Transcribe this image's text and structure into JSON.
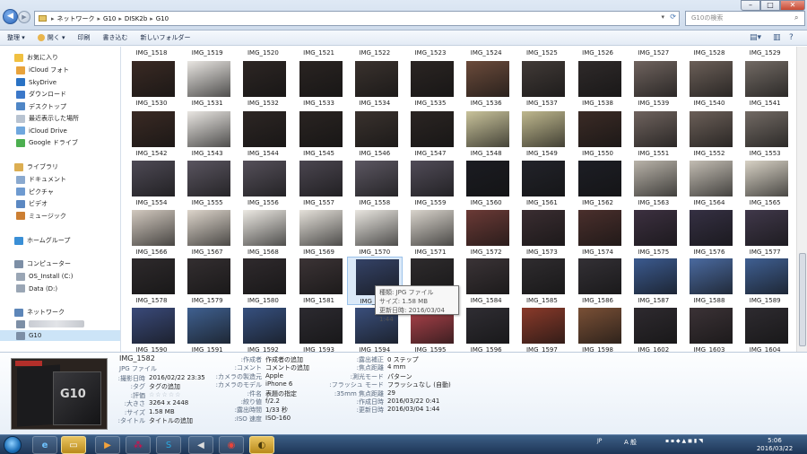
{
  "address": {
    "crumbs": [
      "ネットワーク",
      "G10",
      "DISK2b",
      "G10"
    ],
    "search_placeholder": "G10の検索"
  },
  "toolbar": {
    "organize": "整理 ▾",
    "open": "開く ▾",
    "print": "印刷",
    "burn": "書き込む",
    "new_folder": "新しいフォルダー"
  },
  "navpane": {
    "favorites_header": "お気に入り",
    "favorites": [
      "iCloud フォト",
      "SkyDrive",
      "ダウンロード",
      "デスクトップ",
      "最近表示した場所",
      "iCloud Drive",
      "Google ドライブ"
    ],
    "libraries_header": "ライブラリ",
    "libraries": [
      "ドキュメント",
      "ピクチャ",
      "ビデオ",
      "ミュージック"
    ],
    "homegroup": "ホームグループ",
    "computer_header": "コンピューター",
    "computer": [
      "OS_Install (C:)",
      "Data (D:)"
    ],
    "network_header": "ネットワーク",
    "network_selected": "G10"
  },
  "files": {
    "top_labels": [
      "IMG_1518",
      "IMG_1519",
      "IMG_1520",
      "IMG_1521",
      "IMG_1522",
      "IMG_1523",
      "IMG_1524",
      "IMG_1525",
      "IMG_1526",
      "IMG_1527",
      "IMG_1528",
      "IMG_1529"
    ],
    "rows": [
      [
        "IMG_1530",
        "IMG_1531",
        "IMG_1532",
        "IMG_1533",
        "IMG_1534",
        "IMG_1535",
        "IMG_1536",
        "IMG_1537",
        "IMG_1538",
        "IMG_1539",
        "IMG_1540",
        "IMG_1541"
      ],
      [
        "IMG_1542",
        "IMG_1543",
        "IMG_1544",
        "IMG_1545",
        "IMG_1546",
        "IMG_1547",
        "IMG_1548",
        "IMG_1549",
        "IMG_1550",
        "IMG_1551",
        "IMG_1552",
        "IMG_1553"
      ],
      [
        "IMG_1554",
        "IMG_1555",
        "IMG_1556",
        "IMG_1557",
        "IMG_1558",
        "IMG_1559",
        "IMG_1560",
        "IMG_1561",
        "IMG_1562",
        "IMG_1563",
        "IMG_1564",
        "IMG_1565"
      ],
      [
        "IMG_1566",
        "IMG_1567",
        "IMG_1568",
        "IMG_1569",
        "IMG_1570",
        "IMG_1571",
        "IMG_1572",
        "IMG_1573",
        "IMG_1574",
        "IMG_1575",
        "IMG_1576",
        "IMG_1577"
      ],
      [
        "IMG_1578",
        "IMG_1579",
        "IMG_1580",
        "IMG_1581",
        "IMG_1582",
        "IMG_1583",
        "IMG_1584",
        "IMG_1585",
        "IMG_1586",
        "IMG_1587",
        "IMG_1588",
        "IMG_1589"
      ],
      [
        "IMG_1590",
        "IMG_1591",
        "IMG_1592",
        "IMG_1593",
        "IMG_1594",
        "IMG_1595",
        "IMG_1596",
        "IMG_1597",
        "IMG_1598",
        "IMG_1602",
        "IMG_1603",
        "IMG_1604"
      ]
    ],
    "tones": [
      [
        "#3a2a24",
        "#e9e6e2",
        "#2d2624",
        "#2a2422",
        "#3a322e",
        "#2b2523",
        "#c9c39b",
        "#bfb88e",
        "#3b2b26",
        "#6f635e",
        "#6b5f58",
        "#726a64"
      ],
      [
        "#4e4a55",
        "#5a5560",
        "#55505a",
        "#4b4650",
        "#5c5762",
        "#514c58",
        "#1b1c22",
        "#22232a",
        "#1d1e25",
        "#b9b3a9",
        "#c3bdb3",
        "#d8d2c5"
      ],
      [
        "#d2c9bf",
        "#ddd5cb",
        "#ece9e3",
        "#e5e1da",
        "#e9e6e0",
        "#d9d4cc",
        "#6b3a36",
        "#3a2d31",
        "#4a2f2c",
        "#3c3040",
        "#353043",
        "#40384a"
      ],
      [
        "#2e2a2c",
        "#332e30",
        "#2f2a2d",
        "#3b3335",
        "#344266",
        "#2e2b2d",
        "#3a3336",
        "#2f2c2f",
        "#333035",
        "#3b5a8f",
        "#4a6aa0",
        "#3f5f92"
      ],
      [
        "#3a4a7a",
        "#3f6090",
        "#36507f",
        "#2c2a30",
        "#3a4f7c",
        "#b0434c",
        "#2f2d33",
        "#8a3a2a",
        "#7a5036",
        "#2e2a2f",
        "#3b3236",
        "#2e2b30"
      ]
    ],
    "top_tones": [
      "#3a2a24",
      "#e9e6e2",
      "#2d2624",
      "#2a2422",
      "#3a322e",
      "#2b2523",
      "#6b4b3b",
      "#413a37",
      "#2f2a2a",
      "#6f635e",
      "#6b5f58",
      "#726a64"
    ]
  },
  "tooltip": {
    "type": "種類: JPG ファイル",
    "size": "サイズ: 1.58 MB",
    "modified": "更新日時: 2016/03/04 1:44"
  },
  "details": {
    "filename": "IMG_1582",
    "filetype": "JPG ファイル",
    "left": [
      {
        "label": "撮影日時:",
        "value": "2016/02/22 23:35"
      },
      {
        "label": "タグ:",
        "value": "タグの追加"
      },
      {
        "label": "評価:",
        "value": "☆☆☆☆☆"
      },
      {
        "label": "大きさ:",
        "value": "3264 x 2448"
      },
      {
        "label": "サイズ:",
        "value": "1.58 MB"
      },
      {
        "label": "タイトル:",
        "value": "タイトルの追加"
      }
    ],
    "mid": [
      {
        "label": "作成者:",
        "value": "作成者の追加"
      },
      {
        "label": "コメント:",
        "value": "コメントの追加"
      },
      {
        "label": "カメラの製造元:",
        "value": "Apple"
      },
      {
        "label": "カメラのモデル:",
        "value": "iPhone 6"
      },
      {
        "label": "件名:",
        "value": "表題の指定"
      },
      {
        "label": "絞り値:",
        "value": "f/2.2"
      },
      {
        "label": "露出時間:",
        "value": "1/33 秒"
      },
      {
        "label": "ISO 速度:",
        "value": "ISO-160"
      }
    ],
    "right": [
      {
        "label": "露出補正:",
        "value": "0 ステップ"
      },
      {
        "label": "焦点距離:",
        "value": "4 mm"
      },
      {
        "label": "測光モード:",
        "value": "パターン"
      },
      {
        "label": "フラッシュ モード:",
        "value": "フラッシュなし (自動)"
      },
      {
        "label": "35mm 焦点距離:",
        "value": "29"
      },
      {
        "label": "作成日時:",
        "value": "2016/03/22 0:41"
      },
      {
        "label": "更新日時:",
        "value": "2016/03/04 1:44"
      }
    ],
    "preview_text": "G10"
  },
  "taskbar": {
    "time": "5:06",
    "date": "2016/03/22",
    "ime": "JP",
    "ime_mode": "A 般"
  }
}
